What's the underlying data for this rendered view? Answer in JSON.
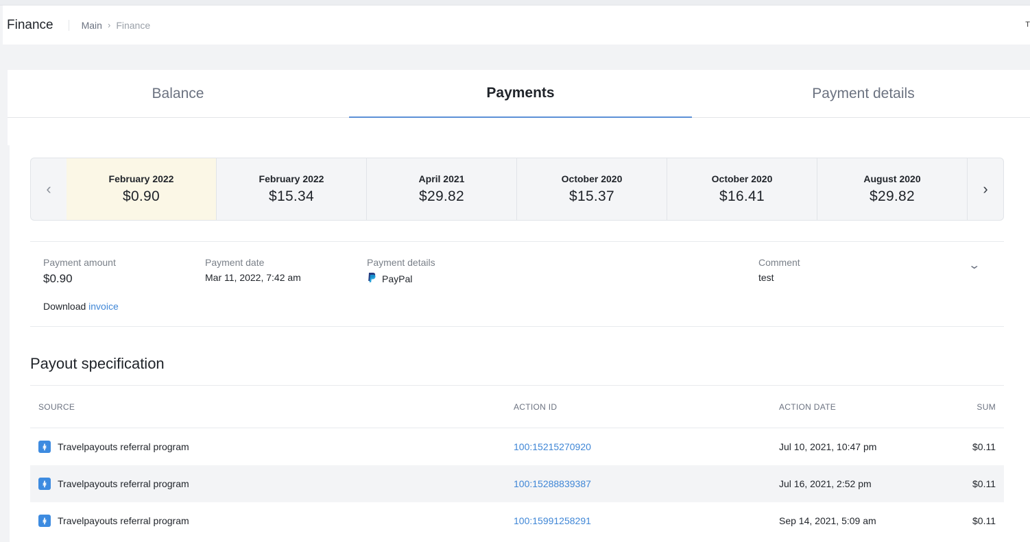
{
  "header": {
    "title": "Finance",
    "breadcrumb": {
      "root": "Main",
      "current": "Finance"
    },
    "edge_glyph": "T"
  },
  "tabs": [
    {
      "label": "Balance",
      "active": false
    },
    {
      "label": "Payments",
      "active": true
    },
    {
      "label": "Payment details",
      "active": false
    }
  ],
  "carousel": {
    "prev_icon": "chevron-left-icon",
    "next_icon": "chevron-right-icon",
    "items": [
      {
        "month": "February 2022",
        "amount": "$0.90",
        "selected": true
      },
      {
        "month": "February 2022",
        "amount": "$15.34",
        "selected": false
      },
      {
        "month": "April 2021",
        "amount": "$29.82",
        "selected": false
      },
      {
        "month": "October 2020",
        "amount": "$15.37",
        "selected": false
      },
      {
        "month": "October 2020",
        "amount": "$16.41",
        "selected": false
      },
      {
        "month": "August 2020",
        "amount": "$29.82",
        "selected": false
      }
    ]
  },
  "payment": {
    "amount_label": "Payment amount",
    "amount": "$0.90",
    "date_label": "Payment date",
    "date": "Mar 11, 2022, 7:42 am",
    "details_label": "Payment details",
    "method": "PayPal",
    "method_icon": "paypal-icon",
    "comment_label": "Comment",
    "comment": "test",
    "download_text": "Download",
    "invoice_link": "invoice",
    "expand_icon": "chevron-down-icon"
  },
  "payout": {
    "title": "Payout specification",
    "columns": {
      "source": "SOURCE",
      "action_id": "ACTION ID",
      "action_date": "ACTION DATE",
      "sum": "SUM"
    },
    "rows": [
      {
        "source": "Travelpayouts referral program",
        "action_id": "100:15215270920",
        "action_date": "Jul 10, 2021, 10:47 pm",
        "sum": "$0.11"
      },
      {
        "source": "Travelpayouts referral program",
        "action_id": "100:15288839387",
        "action_date": "Jul 16, 2021, 2:52 pm",
        "sum": "$0.11"
      },
      {
        "source": "Travelpayouts referral program",
        "action_id": "100:15991258291",
        "action_date": "Sep 14, 2021, 5:09 am",
        "sum": "$0.11"
      }
    ],
    "source_icon": "travelpayouts-icon",
    "source_icon_glyph": "ꬸ"
  },
  "colors": {
    "accent": "#3f86d6",
    "tab_underline": "#5b8fd6",
    "selected_month_bg": "#fbf7e6",
    "alt_row_bg": "#f3f4f6"
  }
}
